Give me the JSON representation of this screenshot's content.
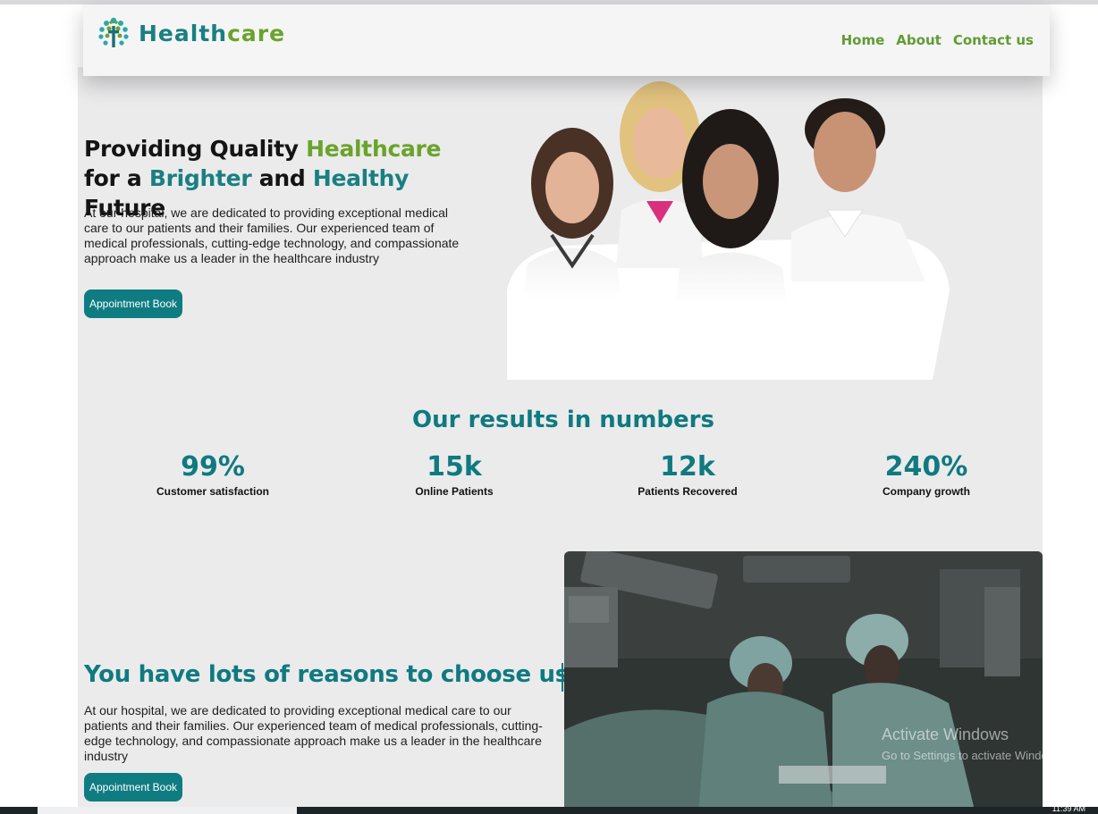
{
  "brand": {
    "name_part1": "Health",
    "name_part2": "care",
    "logo_icon": "tree-cross-logo-icon"
  },
  "nav": {
    "items": [
      "Home",
      "About",
      "Contact us"
    ]
  },
  "hero": {
    "title_1": "Providing Quality ",
    "title_2": "Healthcare",
    "title_3": " for a ",
    "title_4": "Brighter",
    "title_5": " and ",
    "title_6": "Healthy",
    "title_7": " Future",
    "description": "At our hospital, we are dedicated to providing exceptional medical care to our patients and their families. Our experienced team of medical professionals, cutting-edge technology, and compassionate approach make us a leader in the healthcare industry",
    "button": "Appointment Book"
  },
  "results": {
    "title": "Our results in numbers",
    "stats": [
      {
        "value": "99%",
        "label": "Customer satisfaction"
      },
      {
        "value": "15k",
        "label": "Online Patients"
      },
      {
        "value": "12k",
        "label": "Patients Recovered"
      },
      {
        "value": "240%",
        "label": "Company growth"
      }
    ]
  },
  "why": {
    "title": "You have lots of reasons to choose us",
    "description": "At our hospital, we are dedicated to providing exceptional medical care to our patients and their families. Our experienced team of medical professionals, cutting-edge technology, and compassionate approach make us a leader in the healthcare industry",
    "button": "Appointment Book"
  },
  "watermark": {
    "title": "Activate Windows",
    "subtitle": "Go to Settings to activate Windows."
  },
  "taskbar": {
    "clock": "11:39 AM"
  },
  "colors": {
    "teal": "#0f7a80",
    "green": "#6aa32c",
    "button": "#0f7c82",
    "background": "#ebebec"
  }
}
